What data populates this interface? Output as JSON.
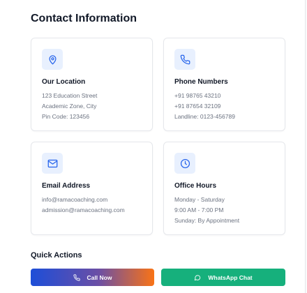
{
  "contact": {
    "title": "Contact Information",
    "cards": [
      {
        "title": "Our Location",
        "icon": "map-pin-icon",
        "lines": [
          "123 Education Street",
          "Academic Zone, City",
          "Pin Code: 123456"
        ]
      },
      {
        "title": "Phone Numbers",
        "icon": "phone-icon",
        "lines": [
          "+91 98765 43210",
          "+91 87654 32109",
          "Landline: 0123-456789"
        ]
      },
      {
        "title": "Email Address",
        "icon": "mail-icon",
        "lines": [
          "info@ramacoaching.com",
          "admission@ramacoaching.com"
        ]
      },
      {
        "title": "Office Hours",
        "icon": "clock-icon",
        "lines": [
          "Monday - Saturday",
          "9:00 AM - 7:00 PM",
          "Sunday: By Appointment"
        ]
      }
    ]
  },
  "quick_actions": {
    "title": "Quick Actions",
    "call_label": "Call Now",
    "whatsapp_label": "WhatsApp Chat"
  },
  "colors": {
    "accent": "#2563eb",
    "icon_bg": "#e8f0fe",
    "whatsapp": "#16b07c",
    "gradient_start": "#1d4ed8",
    "gradient_end": "#f97316"
  }
}
